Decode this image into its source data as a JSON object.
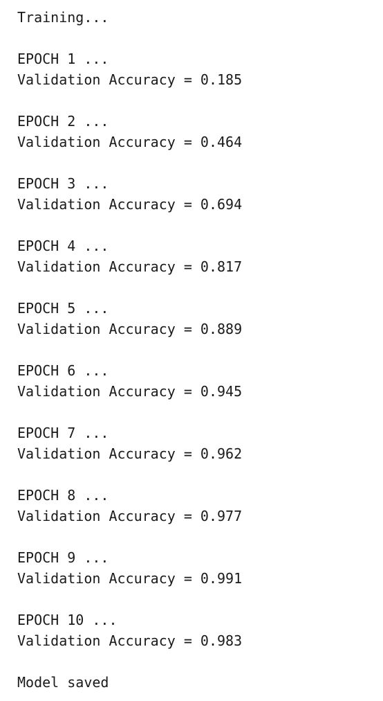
{
  "output": {
    "header": "Training...",
    "epochs": [
      {
        "label": "EPOCH 1 ...",
        "accuracy_line": "Validation Accuracy = 0.185"
      },
      {
        "label": "EPOCH 2 ...",
        "accuracy_line": "Validation Accuracy = 0.464"
      },
      {
        "label": "EPOCH 3 ...",
        "accuracy_line": "Validation Accuracy = 0.694"
      },
      {
        "label": "EPOCH 4 ...",
        "accuracy_line": "Validation Accuracy = 0.817"
      },
      {
        "label": "EPOCH 5 ...",
        "accuracy_line": "Validation Accuracy = 0.889"
      },
      {
        "label": "EPOCH 6 ...",
        "accuracy_line": "Validation Accuracy = 0.945"
      },
      {
        "label": "EPOCH 7 ...",
        "accuracy_line": "Validation Accuracy = 0.962"
      },
      {
        "label": "EPOCH 8 ...",
        "accuracy_line": "Validation Accuracy = 0.977"
      },
      {
        "label": "EPOCH 9 ...",
        "accuracy_line": "Validation Accuracy = 0.991"
      },
      {
        "label": "EPOCH 10 ...",
        "accuracy_line": "Validation Accuracy = 0.983"
      }
    ],
    "footer": "Model saved"
  }
}
